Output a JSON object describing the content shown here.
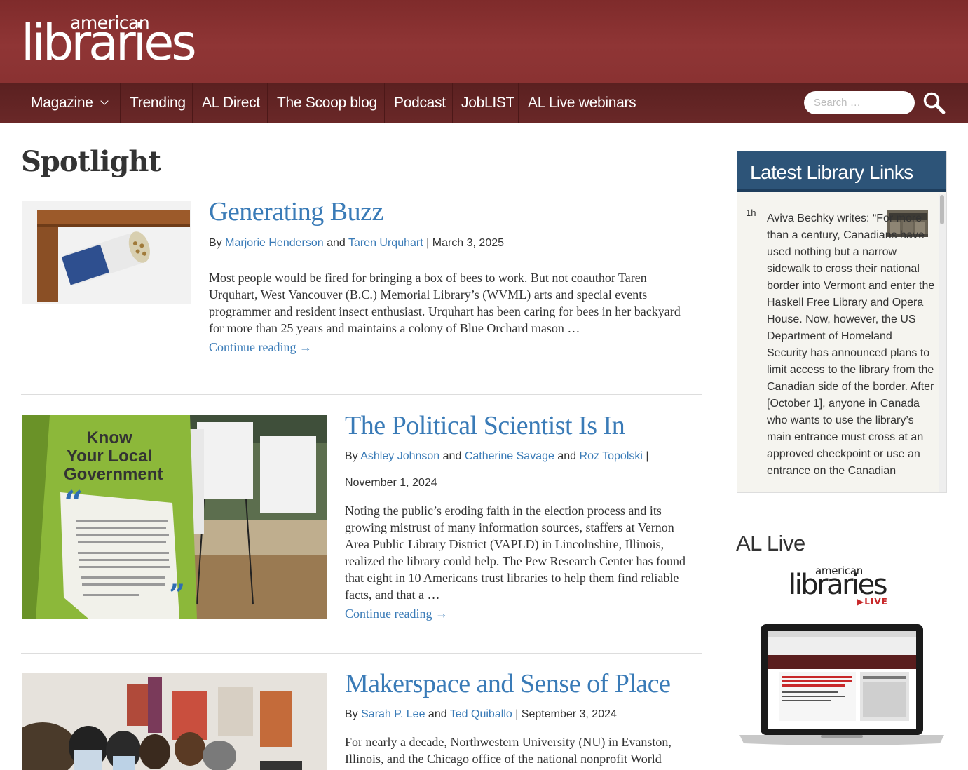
{
  "brand": {
    "logo_small": "american",
    "logo_big": "libraries"
  },
  "nav": {
    "items": [
      "Magazine",
      "Trending",
      "AL Direct",
      "The Scoop blog",
      "Podcast",
      "JobLIST",
      "AL Live webinars"
    ],
    "search_placeholder": "Search …"
  },
  "main": {
    "section_title": "Spotlight",
    "articles": [
      {
        "title": "Generating Buzz",
        "by": "By",
        "authors": [
          "Marjorie Henderson",
          "Taren Urquhart"
        ],
        "and": "and",
        "sep": "|",
        "date": "March 3, 2025",
        "excerpt": "Most people would be fired for bringing a box of bees to work. But not coauthor Taren Urquhart, West Vancouver (B.C.) Memorial Library’s (WVML) arts and special events programmer and resident insect enthusiast. Urquhart has been caring for bees in her backyard for more than 25 years and maintains a colony of Blue Orchard mason …",
        "more": "Continue reading →"
      },
      {
        "title": "The Political Scientist Is In",
        "by": "By",
        "authors": [
          "Ashley Johnson",
          "Catherine Savage",
          "Roz Topolski"
        ],
        "and": "and",
        "sep": "|",
        "date": "November 1, 2024",
        "excerpt": "Noting the public’s eroding faith in the election process and its growing mistrust of many information sources, staffers at Vernon Area Public Library District (VAPLD) in Lincolnshire, Illinois, realized the library could help. The Pew Research Center has found that eight in 10 Americans trust libraries to help them find reliable facts, and that a …",
        "more": "Continue reading →",
        "image_text": [
          "Know",
          "Your Local",
          "Government"
        ]
      },
      {
        "title": "Makerspace and Sense of Place",
        "by": "By",
        "authors": [
          "Sarah P. Lee",
          "Ted Quiballo"
        ],
        "and": "and",
        "sep": "|",
        "date": "September 3, 2024",
        "excerpt": "For nearly a decade, Northwestern University (NU) in Evanston, Illinois, and the Chicago office of the national nonprofit World"
      }
    ]
  },
  "sidebar": {
    "links_title": "Latest Library Links",
    "link_age": "1h",
    "link_text": "Aviva Bechky writes: “For more than a century, Canadians have used nothing but a narrow sidewalk to cross their national border into Vermont and enter the Haskell Free Library and Opera House. Now, however, the US Department of Homeland Security has announced plans to limit access to the library from the Canadian side of the border. After [October 1], anyone in Canada who wants to use the library’s main entrance must cross at an approved checkpoint or use an entrance on the Canadian",
    "allive_title": "AL Live",
    "allive_logo_small": "american",
    "allive_logo_big": "libraries",
    "allive_logo_live": "▶LIVE"
  },
  "colors": {
    "header": "#8f3535",
    "nav": "#5a2020",
    "link": "#3a7bb7",
    "sidebar_head": "#2d5478"
  }
}
